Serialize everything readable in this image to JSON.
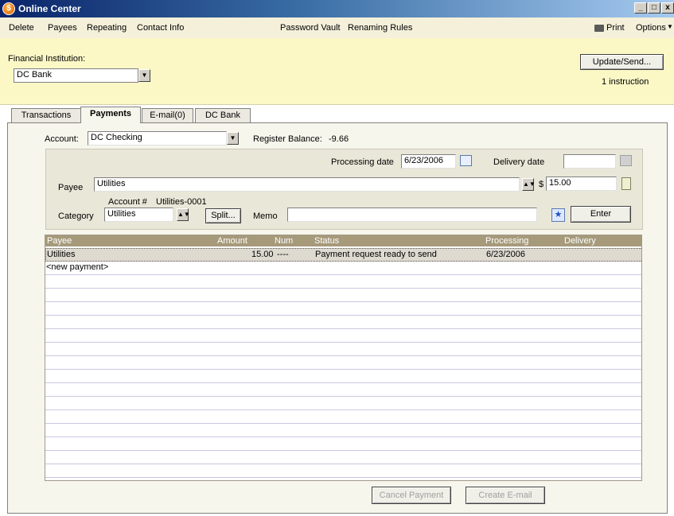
{
  "window": {
    "title": "Online Center",
    "controls": [
      "_",
      "□",
      "x"
    ]
  },
  "menu": {
    "left": [
      "Delete",
      "Payees",
      "Repeating",
      "Contact Info"
    ],
    "center": [
      "Password Vault",
      "Renaming Rules"
    ],
    "print": "Print",
    "options": "Options"
  },
  "institution": {
    "label": "Financial Institution:",
    "value": "DC Bank",
    "update_button": "Update/Send...",
    "instruction_count": "1 instruction"
  },
  "tabs": [
    "Transactions",
    "Payments",
    "E-mail(0)",
    "DC Bank"
  ],
  "account": {
    "label": "Account:",
    "value": "DC Checking",
    "register_label": "Register Balance:",
    "register_value": "-9.66"
  },
  "entry": {
    "processing_label": "Processing date",
    "processing_value": "6/23/2006",
    "delivery_label": "Delivery date",
    "delivery_value": "",
    "payee_label": "Payee",
    "payee_value": "Utilities",
    "currency": "$",
    "amount_value": "15.00",
    "account_num_label": "Account #",
    "account_num_value": "Utilities-0001",
    "category_label": "Category",
    "category_value": "Utilities",
    "split_button": "Split...",
    "memo_label": "Memo",
    "memo_value": "",
    "enter_button": "Enter"
  },
  "table": {
    "columns": [
      "Payee",
      "Amount",
      "Num",
      "Status",
      "Processing",
      "Delivery"
    ],
    "rows": [
      {
        "payee": "Utilities",
        "amount": "15.00",
        "num": "----",
        "status": "Payment request ready to send",
        "processing": "6/23/2006",
        "delivery": ""
      }
    ],
    "new_payment": "<new payment>"
  },
  "footer": {
    "cancel_button": "Cancel Payment",
    "email_button": "Create E-mail"
  }
}
